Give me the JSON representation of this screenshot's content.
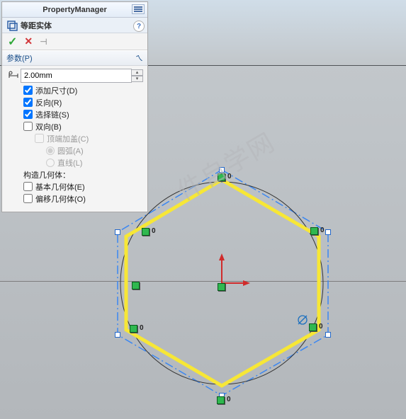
{
  "pm": {
    "title": "PropertyManager",
    "feature_name": "等距实体",
    "help": "?",
    "section_params": "参数(P)",
    "distance": "2.00mm",
    "opts": {
      "add_dim": "添加尺寸(D)",
      "reverse": "反向(R)",
      "select_chain": "选择链(S)",
      "bidir": "双向(B)",
      "cap_ends": "顶端加盖(C)",
      "arcs": "圆弧(A)",
      "lines": "直线(L)",
      "construct_label": "构造几何体：",
      "base_geo": "基本几何体(E)",
      "offset_geo": "偏移几何体(O)"
    }
  },
  "markers": {
    "zero": "0"
  },
  "watermark": "件自学网"
}
